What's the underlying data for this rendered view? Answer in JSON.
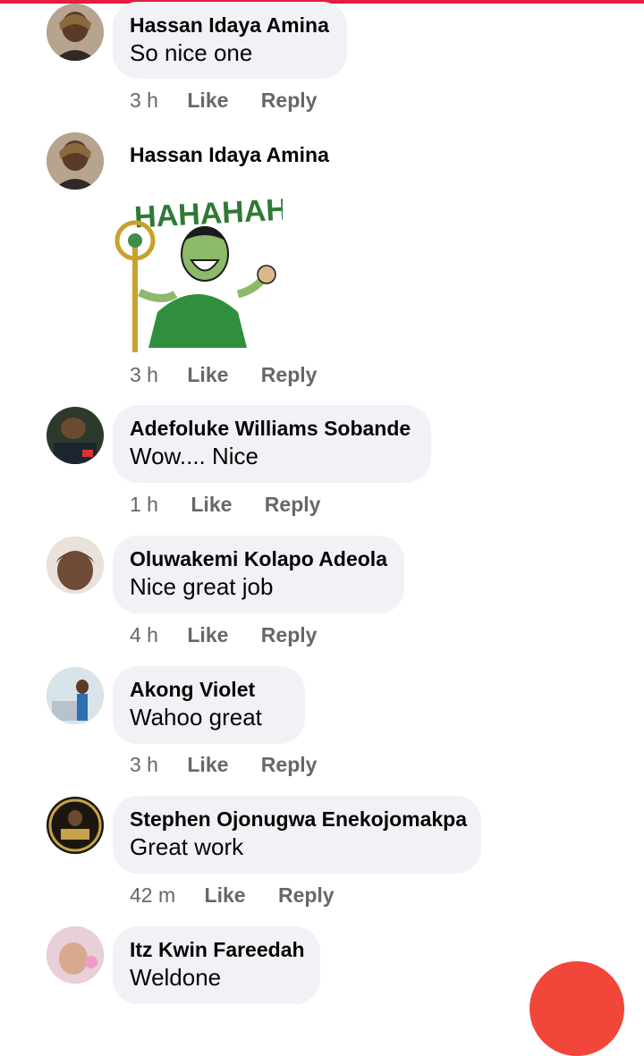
{
  "colors": {
    "accent": "#e41e3f",
    "bubble": "#f0f2f5",
    "meta": "#65676b",
    "fab": "#f0473a"
  },
  "comments": [
    {
      "name": "Hassan Idaya Amina",
      "text": "So nice one",
      "time": "3 h",
      "like": "Like",
      "reply": "Reply"
    },
    {
      "name": "Hassan Idaya Amina",
      "sticker": "laughing-green-villain-sticker",
      "sticker_text": "HAHAHAHA",
      "time": "3 h",
      "like": "Like",
      "reply": "Reply"
    },
    {
      "name": "Adefoluke Williams Sobande",
      "text": "Wow.... Nice",
      "time": "1 h",
      "like": "Like",
      "reply": "Reply"
    },
    {
      "name": "Oluwakemi Kolapo Adeola",
      "text": "Nice great job",
      "time": "4 h",
      "like": "Like",
      "reply": "Reply"
    },
    {
      "name": "Akong Violet",
      "text": "Wahoo  great",
      "time": "3 h",
      "like": "Like",
      "reply": "Reply"
    },
    {
      "name": "Stephen Ojonugwa Enekojomakpa",
      "text": "Great work",
      "time": "42 m",
      "like": "Like",
      "reply": "Reply"
    },
    {
      "name": "Itz Kwin Fareedah",
      "text": "Weldone"
    }
  ]
}
